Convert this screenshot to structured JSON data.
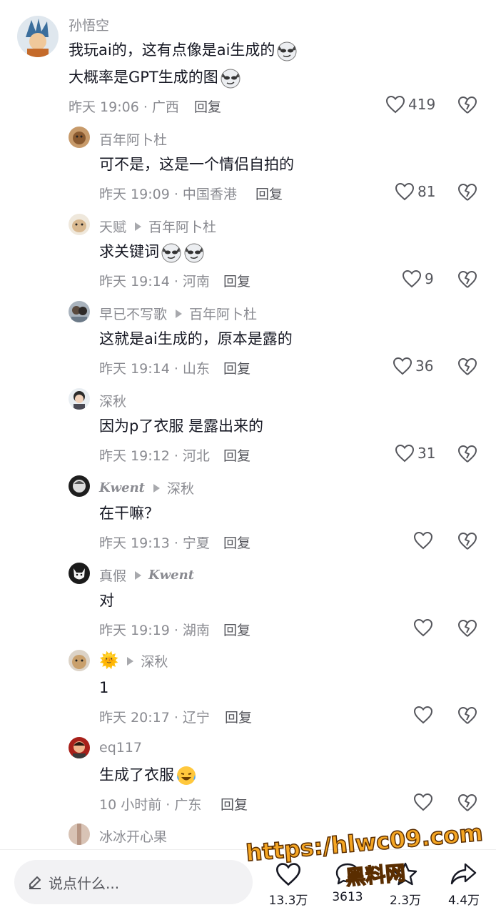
{
  "comments": [
    {
      "user": "孙悟空",
      "line1": "我玩ai的，这有点像是ai生成的",
      "line2": "大概率是GPT生成的图",
      "time": "昨天 19:06 · 广西",
      "reply": "回复",
      "likes": "419"
    },
    {
      "user": "百年阿卜杜",
      "text": "可不是，这是一个情侣自拍的",
      "time": "昨天 19:09 · 中国香港",
      "reply": "回复",
      "likes": "81"
    },
    {
      "user": "天赋",
      "to": "百年阿卜杜",
      "text": "求关键词",
      "time": "昨天 19:14 · 河南",
      "reply": "回复",
      "likes": "9"
    },
    {
      "user": "早已不写歌",
      "to": "百年阿卜杜",
      "text": "这就是ai生成的，原本是露的",
      "time": "昨天 19:14 · 山东",
      "reply": "回复",
      "likes": "36"
    },
    {
      "user": "深秋",
      "text": "因为p了衣服 是露出来的",
      "time": "昨天 19:12 · 河北",
      "reply": "回复",
      "likes": "31"
    },
    {
      "user": "Kwent",
      "to": "深秋",
      "text": "在干嘛？",
      "time": "昨天 19:13 · 宁夏",
      "reply": "回复",
      "likes": ""
    },
    {
      "user": "真假",
      "to": "Kwent",
      "text": "对",
      "time": "昨天 19:19 · 湖南",
      "reply": "回复",
      "likes": ""
    },
    {
      "user": "🌞",
      "to": "深秋",
      "text": "1",
      "time": "昨天 20:17 · 辽宁",
      "reply": "回复",
      "likes": ""
    },
    {
      "user": "eq117",
      "text": "生成了衣服",
      "time": "10 小时前 · 广东",
      "reply": "回复",
      "likes": ""
    },
    {
      "user": "冰冰开心果"
    }
  ],
  "bottom": {
    "placeholder": "说点什么...",
    "likes": "13.3万",
    "comments": "3613",
    "favorites": "2.3万",
    "shares": "4.4万"
  },
  "watermark": {
    "url": "https:/hlwc09.com",
    "name": "黑料网"
  },
  "colors": {
    "secondary_text": "#8a8b91",
    "primary_text": "#161823",
    "watermark": "#f5a623"
  }
}
